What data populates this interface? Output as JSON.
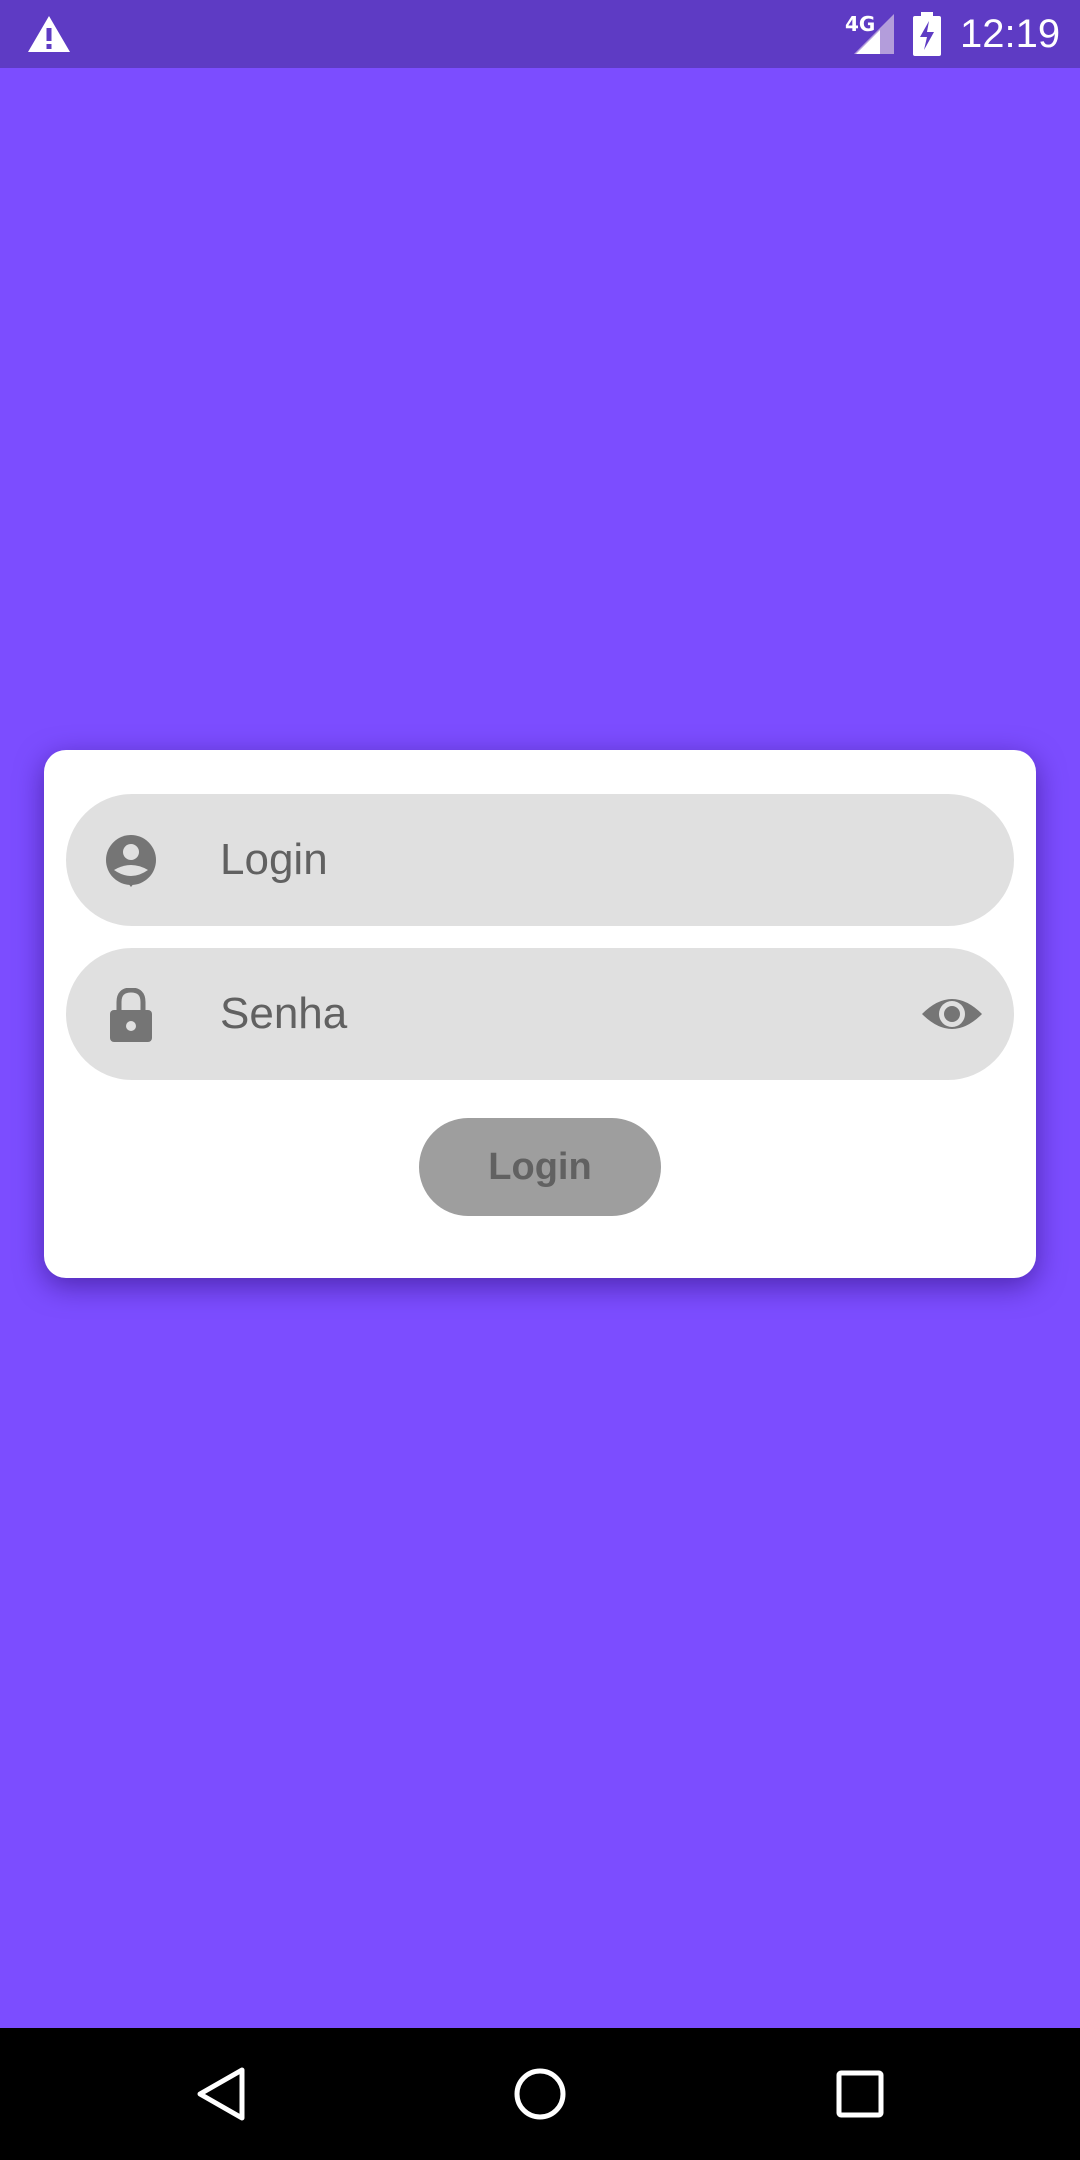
{
  "status_bar": {
    "network_type": "4G",
    "time": "12:19",
    "icons": [
      "warning-icon",
      "signal-icon",
      "battery-charging-icon"
    ]
  },
  "login_form": {
    "login_placeholder": "Login",
    "password_placeholder": "Senha",
    "submit_label": "Login",
    "icons": {
      "login": "account-circle-icon",
      "password": "lock-icon",
      "toggle_visibility": "eye-icon"
    }
  },
  "nav_bar": {
    "icons": [
      "back-icon",
      "home-icon",
      "recents-icon"
    ]
  },
  "colors": {
    "background": "#7c4dff",
    "status_bar": "#5e3bc4",
    "field_bg": "#e0e0e0",
    "button_bg": "#9e9e9e",
    "icon_gray": "#757575"
  }
}
